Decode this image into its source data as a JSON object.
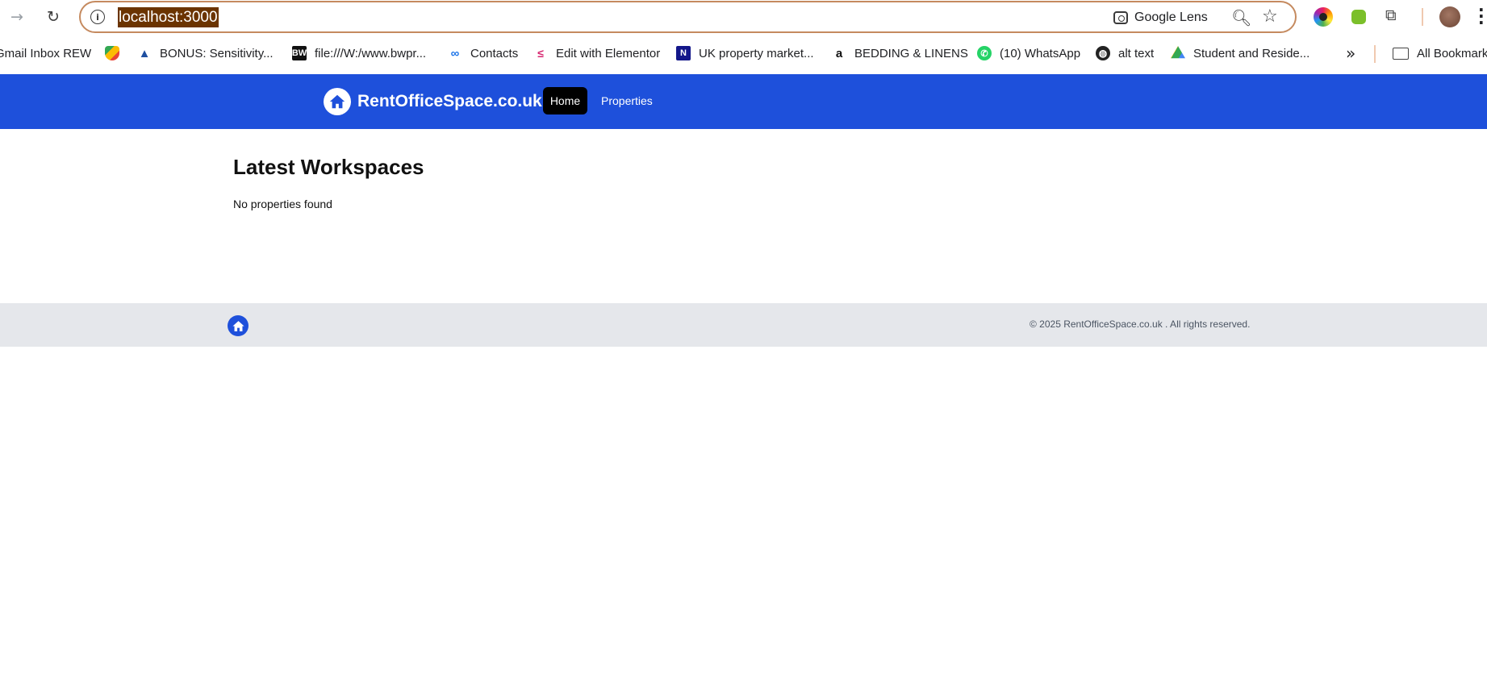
{
  "browser": {
    "url": "localhost:3000",
    "lens_label": "Google Lens",
    "bookmarks": [
      {
        "label": "Gmail Inbox REW",
        "icon": "gmail-icon"
      },
      {
        "label": "",
        "icon": "google-maps-icon"
      },
      {
        "label": "BONUS: Sensitivity...",
        "icon": "triangle-logo-icon"
      },
      {
        "label": "file:///W:/www.bwpr...",
        "icon": "bw-icon"
      },
      {
        "label": "Contacts",
        "icon": "contacts-link-icon"
      },
      {
        "label": "Edit with Elementor",
        "icon": "elementor-icon"
      },
      {
        "label": "UK property market...",
        "icon": "n-icon"
      },
      {
        "label": "BEDDING & LINENS",
        "icon": "amazon-icon"
      },
      {
        "label": "(10) WhatsApp",
        "icon": "whatsapp-icon"
      },
      {
        "label": "alt text",
        "icon": "globe-icon"
      },
      {
        "label": "Student and Reside...",
        "icon": "google-drive-icon"
      }
    ],
    "all_bookmarks_label": "All Bookmarks"
  },
  "site": {
    "brand_name": "RentOfficeSpace.co.uk",
    "nav": {
      "home": "Home",
      "properties": "Properties"
    },
    "accent_color": "#1e50db"
  },
  "main": {
    "title": "Latest Workspaces",
    "empty_message": "No properties found"
  },
  "footer": {
    "copyright": "© 2025 RentOfficeSpace.co.uk . All rights reserved."
  }
}
